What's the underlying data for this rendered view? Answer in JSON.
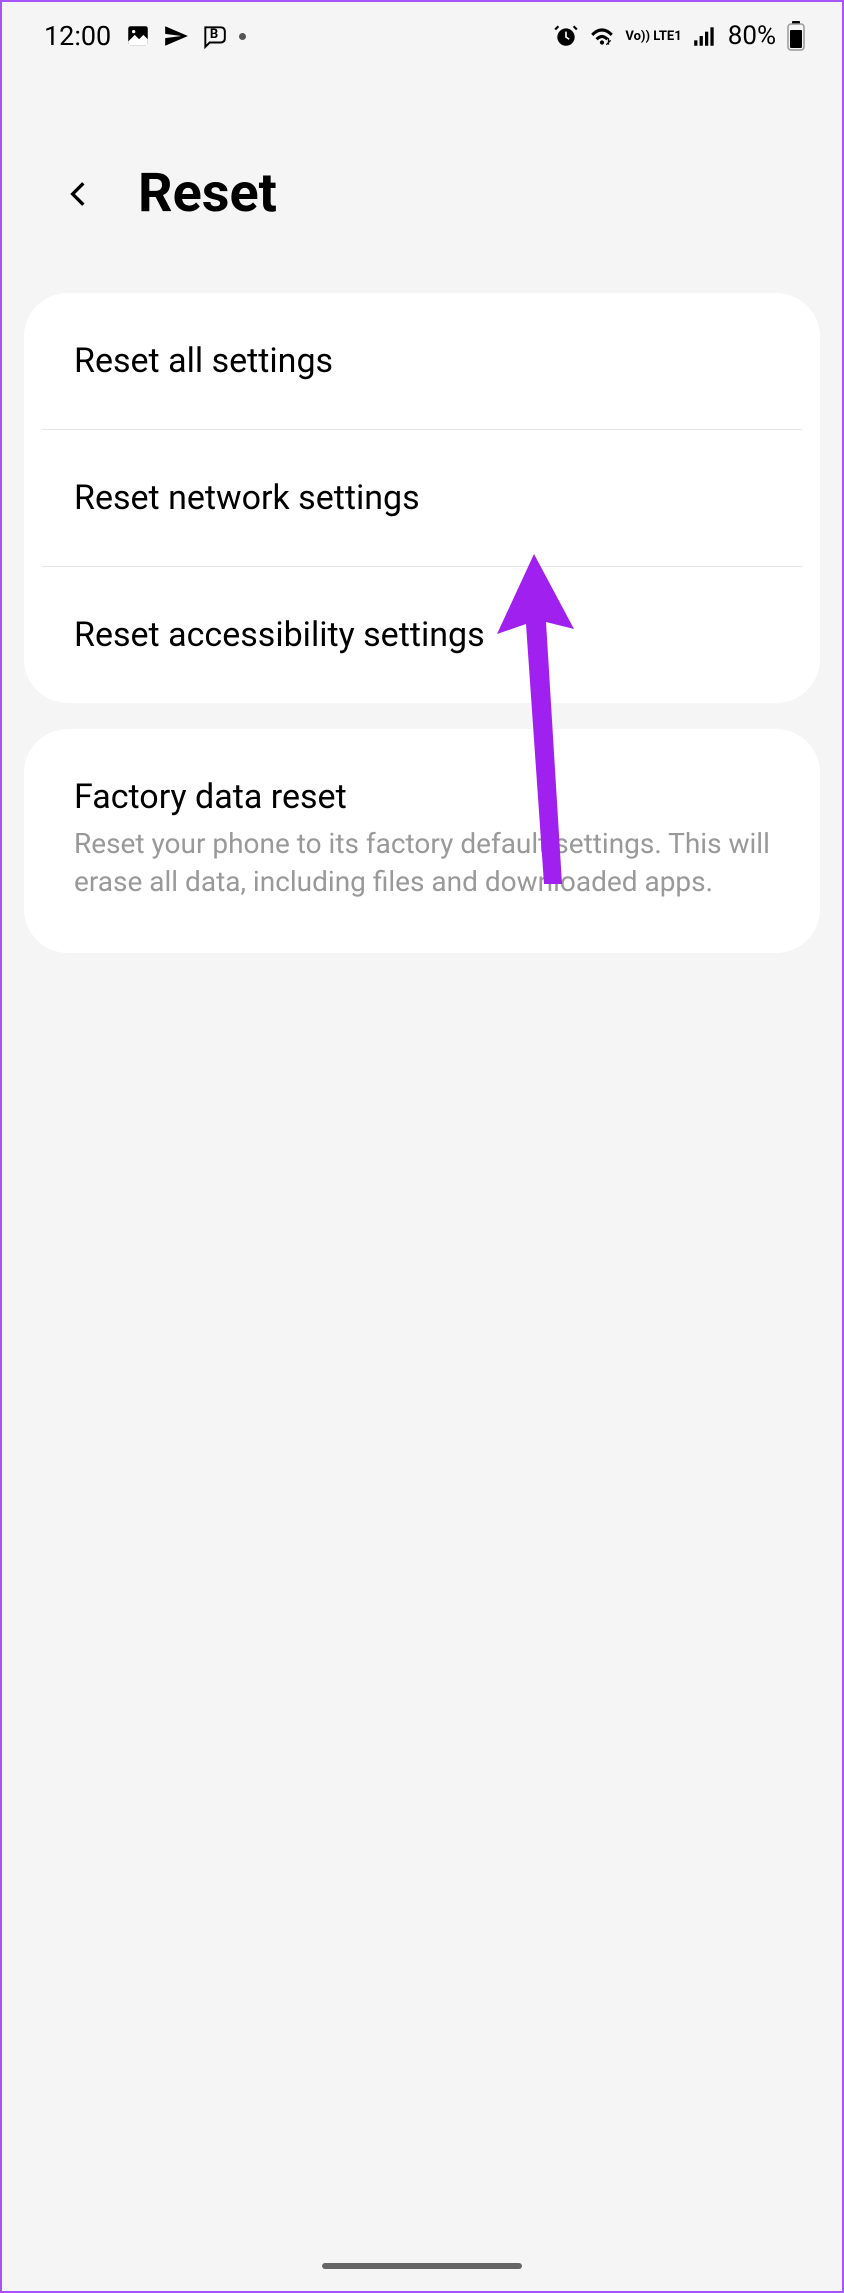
{
  "status_bar": {
    "time": "12:00",
    "battery_percent": "80%",
    "lte_label": "Vo)) LTE1"
  },
  "header": {
    "title": "Reset"
  },
  "reset_options": {
    "items": [
      {
        "label": "Reset all settings"
      },
      {
        "label": "Reset network settings"
      },
      {
        "label": "Reset accessibility settings"
      }
    ]
  },
  "factory_reset": {
    "title": "Factory data reset",
    "description": "Reset your phone to its factory default settings. This will erase all data, including files and downloaded apps."
  },
  "annotation": {
    "color": "#a020f0"
  }
}
